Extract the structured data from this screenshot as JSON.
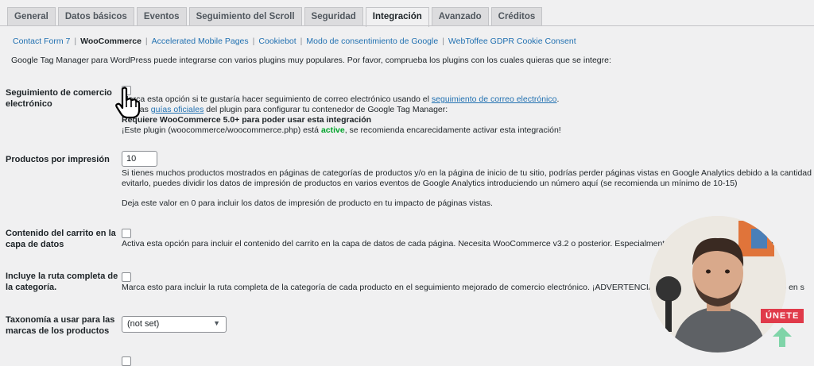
{
  "tabs": [
    "General",
    "Datos básicos",
    "Eventos",
    "Seguimiento del Scroll",
    "Seguridad",
    "Integración",
    "Avanzado",
    "Créditos"
  ],
  "active_tab_index": 5,
  "subnav": [
    "Contact Form 7",
    "WooCommerce",
    "Accelerated Mobile Pages",
    "Cookiebot",
    "Modo de consentimiento de Google",
    "WebToffee GDPR Cookie Consent"
  ],
  "active_subnav_index": 1,
  "intro": "Google Tag Manager para WordPress puede integrarse con varios plugins muy populares. Por favor, comprueba los plugins con los cuales quieras que se integre:",
  "ecommerce": {
    "label_line1": "Seguimiento de comercio",
    "label_line2": "electrónico",
    "line1_pre": "Marca esta opción si te gustaría hacer seguimiento de correo electrónico usando el ",
    "line1_link": "seguimiento de correo electrónico",
    "line1_post": ".",
    "line2_pre": "Lee las ",
    "line2_link": "guías oficiales",
    "line2_post": " del plugin para configurar tu contenedor de Google Tag Manager:",
    "line3": "Requiere WooCommerce 5.0+ para poder usar esta integración",
    "line4_pre": "¡Este plugin (woocommerce/woocommerce.php) está ",
    "line4_status": "active",
    "line4_post": ", se recomienda encarecidamente activar esta integración!"
  },
  "impressions": {
    "label": "Productos por impresión",
    "value": "10",
    "desc1": "Si tienes muchos productos mostrados en páginas de categorías de productos y/o en la página de inicio de tu sitio, podrías perder páginas vistas en Google Analytics debido a la cantidad de datos",
    "desc2": "evitarlo, puedes dividir los datos de impresión de productos en varios eventos de Google Analytics introduciendo un número aquí (se recomienda un mínimo de 10-15)",
    "desc3": "Deja este valor en 0 para incluir los datos de impresión de producto en tu impacto de páginas vistas."
  },
  "cart": {
    "label_line1": "Contenido del carrito en la",
    "label_line2": "capa de datos",
    "desc": "Activa esta opción para incluir el contenido del carrito en la capa de datos de cada página. Necesita WooCommerce v3.2 o posterior. Especialmente útil para personalización de"
  },
  "category_path": {
    "label_line1": "Incluye la ruta completa de",
    "label_line2": "la categoría.",
    "desc": "Marca esto para incluir la ruta completa de la categoría de cada producto en el seguimiento mejorado de comercio electrónico. ¡ADVERTENCIA! ¡Esto puede afectar al rendimiento en s"
  },
  "taxonomy": {
    "label_line1": "Taxonomía a usar para las",
    "label_line2": "marcas de los productos",
    "selected": "(not set)"
  },
  "webcam_badge": "ÚNETE",
  "colors": {
    "link": "#2271b1",
    "active_green": "#00a32a",
    "badge": "#e03a4a",
    "arrow": "#7fd4a8"
  }
}
